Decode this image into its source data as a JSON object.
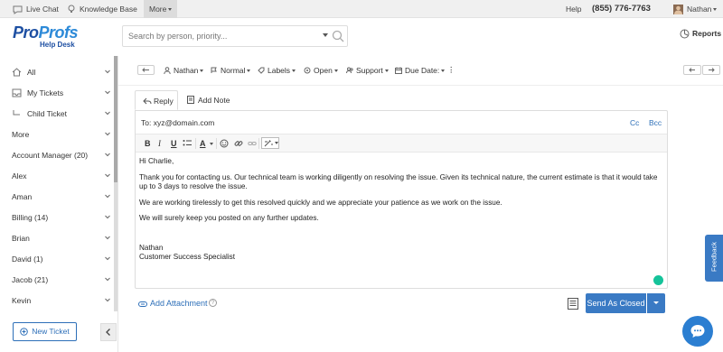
{
  "topbar": {
    "live_chat": "Live Chat",
    "knowledge_base": "Knowledge Base",
    "more": "More",
    "help": "Help",
    "phone": "(855) 776-7763",
    "user": "Nathan"
  },
  "header": {
    "logo_pro": "Pro",
    "logo_profs": "Profs",
    "logo_sub": "Help Desk",
    "search_placeholder": "Search by person, priority...",
    "reports": "Reports"
  },
  "sidebar": {
    "items": [
      {
        "label": "All",
        "icon": "home-icon"
      },
      {
        "label": "My Tickets",
        "icon": "inbox-icon"
      },
      {
        "label": "Child Ticket",
        "icon": "child-ticket-icon"
      },
      {
        "label": "More"
      },
      {
        "label": "Account Manager (20)"
      },
      {
        "label": "Alex"
      },
      {
        "label": "Aman"
      },
      {
        "label": "Billing (14)"
      },
      {
        "label": "Brian"
      },
      {
        "label": "David (1)"
      },
      {
        "label": "Jacob (21)"
      },
      {
        "label": "Kevin"
      }
    ],
    "new_ticket": "New Ticket"
  },
  "toolbar": {
    "assignee": "Nathan",
    "priority": "Normal",
    "labels": "Labels",
    "status": "Open",
    "team": "Support",
    "due_date": "Due Date:"
  },
  "reply": {
    "tab_reply": "Reply",
    "tab_note": "Add Note",
    "to": "To: xyz@domain.com",
    "cc": "Cc",
    "bcc": "Bcc",
    "fmt_bold": "B",
    "fmt_italic": "I",
    "fmt_underline": "U",
    "fmt_color": "A",
    "body": {
      "greeting": "Hi Charlie,",
      "p1": "Thank you for contacting us. Our technical team is working diligently on resolving the issue. Given its technical nature, the current estimate is that it would take up to 3 days to resolve the issue.",
      "p2": "We are working tirelessly to get this resolved quickly and we appreciate your patience as we work on the issue.",
      "p3": "We will surely keep you posted on any further updates.",
      "sign_name": "Nathan",
      "sign_title": "Customer Success Specialist"
    },
    "add_attachment": "Add Attachment",
    "help_mark": "?",
    "send": "Send As Closed"
  },
  "feedback": "Feedback",
  "colors": {
    "brand_dark": "#1d4fa2",
    "brand_light": "#2d8ad8",
    "button_blue": "#3a7ac4",
    "grammarly": "#15c39a"
  }
}
